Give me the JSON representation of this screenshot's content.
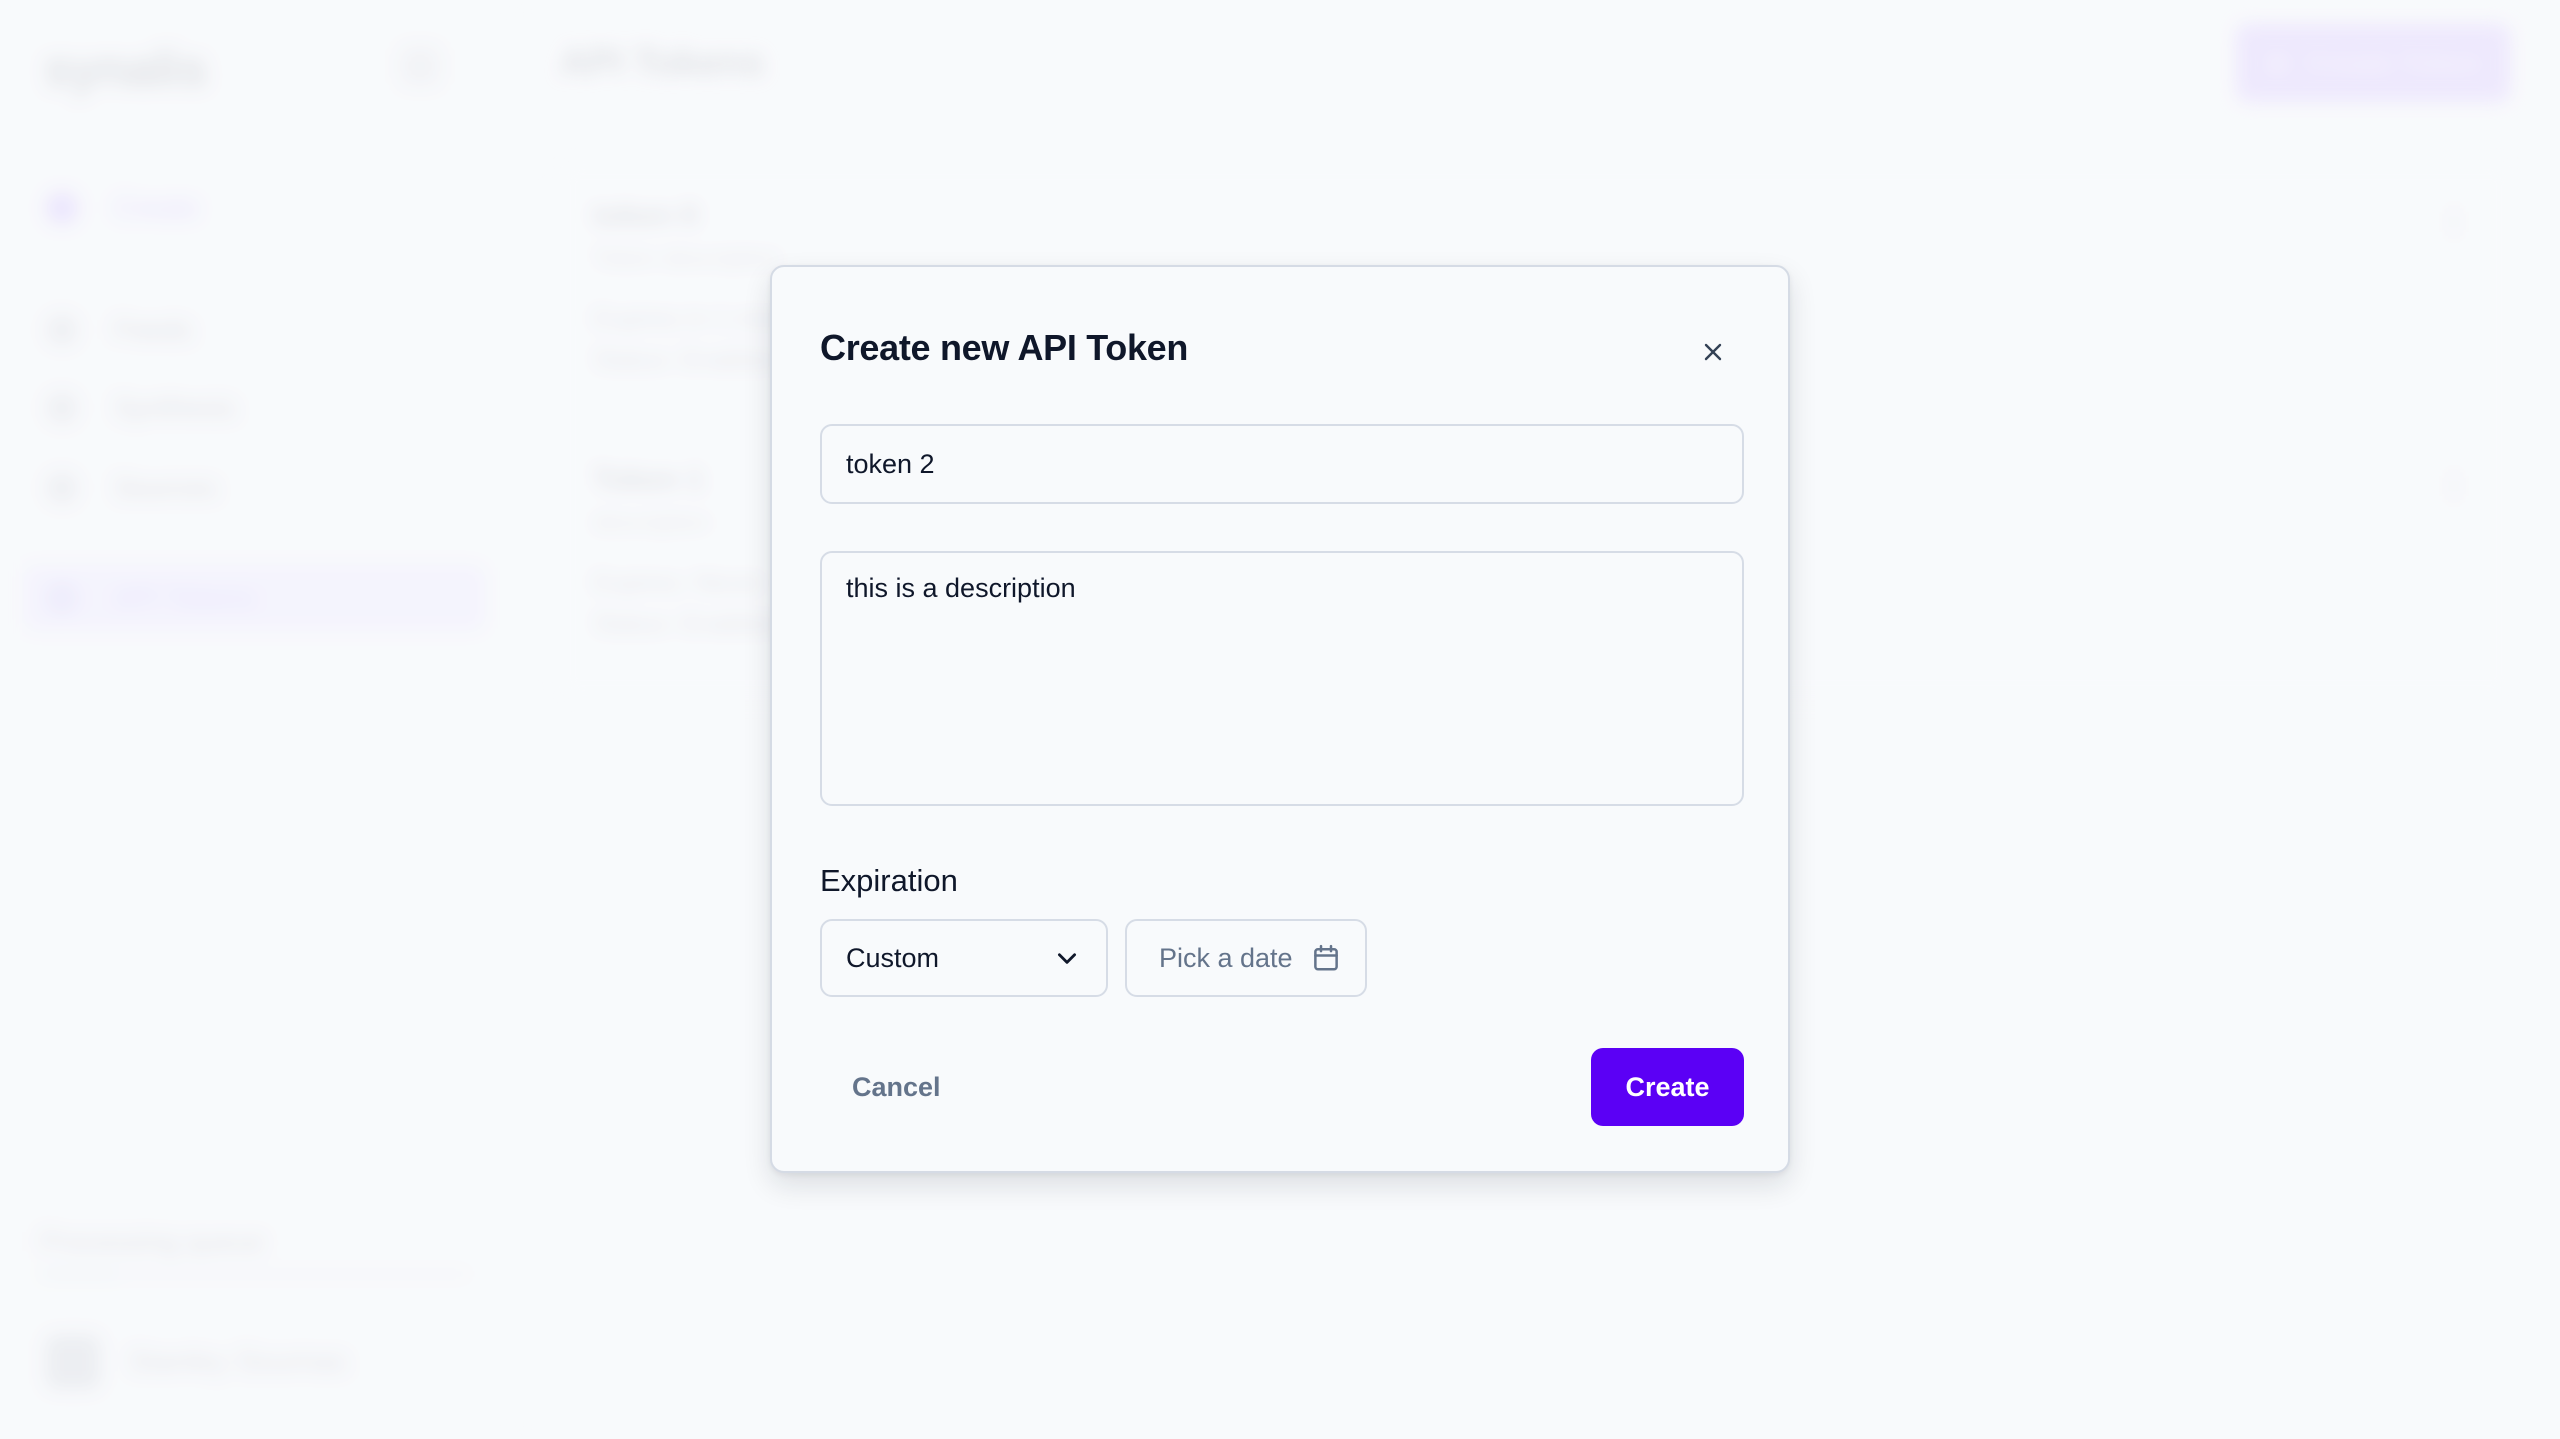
{
  "app": {
    "logo": "synalis",
    "sidebar": {
      "create_label": "Create",
      "items": [
        {
          "label": "Feeds",
          "icon": "feed-icon"
        },
        {
          "label": "Synthesis",
          "icon": "synthesis-icon"
        },
        {
          "label": "Sources",
          "icon": "sources-icon"
        },
        {
          "label": "API Tokens",
          "icon": "key-icon",
          "active": true
        }
      ],
      "processing_label": "Processing queue",
      "processing_progress": 0.18,
      "user_name": "Stanley Soumas"
    },
    "header": {
      "title": "API Tokens",
      "create_button_label": "Create Token"
    },
    "tokens": [
      {
        "name": "token 0",
        "description": "Token description",
        "line1": "Expires in 1 month",
        "line2": "Status: Enabled"
      },
      {
        "name": "Token 1",
        "description": "description",
        "line1": "Expires: Never",
        "line2": "Status: Enabled"
      }
    ]
  },
  "modal": {
    "title": "Create new API Token",
    "close_icon": "close-icon",
    "name_value": "token 2",
    "description_value": "this is a description",
    "expiration_label": "Expiration",
    "expiration_select_value": "Custom",
    "date_picker_placeholder": "Pick a date",
    "cancel_label": "Cancel",
    "create_label": "Create"
  },
  "colors": {
    "primary": "#5b00f5",
    "text": "#0f172a",
    "muted": "#64748b",
    "border": "#d6dce6",
    "background": "#f8fafc"
  }
}
